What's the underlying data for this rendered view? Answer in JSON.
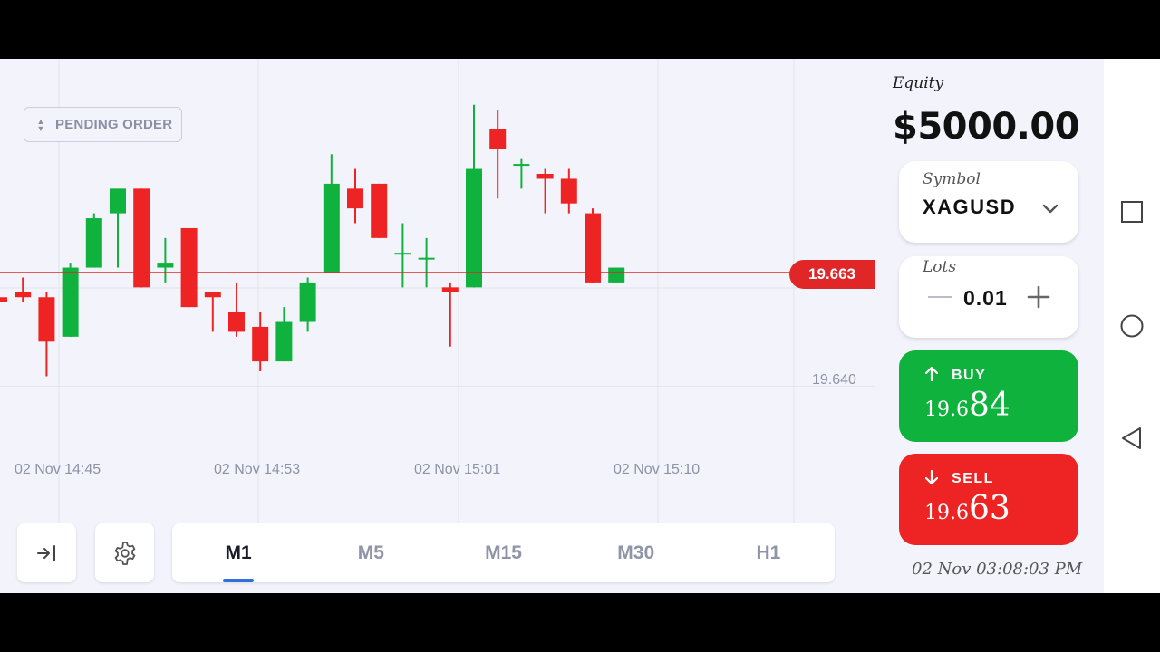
{
  "pending_order": {
    "label": "PENDING ORDER"
  },
  "chart": {
    "current_price_tag": "19.663",
    "y_tick": "19.640",
    "time_labels": [
      "02 Nov 14:45",
      "02 Nov 14:53",
      "02 Nov 15:01",
      "02 Nov 15:10"
    ]
  },
  "chart_data": {
    "type": "candlestick",
    "symbol": "XAGUSD",
    "current_price": 19.663,
    "y_tick_labels": [
      "19.640"
    ],
    "x_tick_labels": [
      "02 Nov 14:45",
      "02 Nov 14:53",
      "02 Nov 15:01",
      "02 Nov 15:10"
    ],
    "colors": {
      "up": "#0fb23c",
      "down": "#ee2424",
      "price_line": "#e02626"
    },
    "candles": [
      {
        "o": 19.658,
        "h": 19.659,
        "l": 19.656,
        "c": 19.657
      },
      {
        "o": 19.659,
        "h": 19.662,
        "l": 19.657,
        "c": 19.658
      },
      {
        "o": 19.658,
        "h": 19.659,
        "l": 19.642,
        "c": 19.649
      },
      {
        "o": 19.65,
        "h": 19.665,
        "l": 19.65,
        "c": 19.664
      },
      {
        "o": 19.664,
        "h": 19.675,
        "l": 19.664,
        "c": 19.674
      },
      {
        "o": 19.675,
        "h": 19.679,
        "l": 19.664,
        "c": 19.68
      },
      {
        "o": 19.68,
        "h": 19.68,
        "l": 19.66,
        "c": 19.66
      },
      {
        "o": 19.664,
        "h": 19.67,
        "l": 19.661,
        "c": 19.665
      },
      {
        "o": 19.672,
        "h": 19.672,
        "l": 19.656,
        "c": 19.656
      },
      {
        "o": 19.659,
        "h": 19.659,
        "l": 19.651,
        "c": 19.658
      },
      {
        "o": 19.655,
        "h": 19.661,
        "l": 19.65,
        "c": 19.651
      },
      {
        "o": 19.652,
        "h": 19.655,
        "l": 19.643,
        "c": 19.645
      },
      {
        "o": 19.645,
        "h": 19.656,
        "l": 19.645,
        "c": 19.653
      },
      {
        "o": 19.653,
        "h": 19.662,
        "l": 19.651,
        "c": 19.661
      },
      {
        "o": 19.663,
        "h": 19.687,
        "l": 19.663,
        "c": 19.681
      },
      {
        "o": 19.68,
        "h": 19.684,
        "l": 19.673,
        "c": 19.676
      },
      {
        "o": 19.681,
        "h": 19.681,
        "l": 19.67,
        "c": 19.67
      },
      {
        "o": 19.667,
        "h": 19.673,
        "l": 19.66,
        "c": 19.667
      },
      {
        "o": 19.666,
        "h": 19.67,
        "l": 19.66,
        "c": 19.666
      },
      {
        "o": 19.66,
        "h": 19.661,
        "l": 19.648,
        "c": 19.659
      },
      {
        "o": 19.66,
        "h": 19.697,
        "l": 19.66,
        "c": 19.684
      },
      {
        "o": 19.692,
        "h": 19.696,
        "l": 19.678,
        "c": 19.688
      },
      {
        "o": 19.685,
        "h": 19.686,
        "l": 19.68,
        "c": 19.685
      },
      {
        "o": 19.683,
        "h": 19.684,
        "l": 19.675,
        "c": 19.682
      },
      {
        "o": 19.682,
        "h": 19.684,
        "l": 19.675,
        "c": 19.677
      },
      {
        "o": 19.675,
        "h": 19.676,
        "l": 19.661,
        "c": 19.661
      },
      {
        "o": 19.661,
        "h": 19.664,
        "l": 19.661,
        "c": 19.664
      }
    ]
  },
  "toolbar": {
    "timeframes": [
      "M1",
      "M5",
      "M15",
      "M30",
      "H1"
    ],
    "active": "M1"
  },
  "panel": {
    "equity_label": "Equity",
    "equity_value": "$5000.00",
    "symbol_label": "Symbol",
    "symbol_value": "XAGUSD",
    "lots_label": "Lots",
    "lots_value": "0.01",
    "buy": {
      "label": "BUY",
      "price_small": "19.6",
      "price_big": "84"
    },
    "sell": {
      "label": "SELL",
      "price_small": "19.6",
      "price_big": "63"
    },
    "datetime": "02 Nov 03:08:03 PM"
  }
}
